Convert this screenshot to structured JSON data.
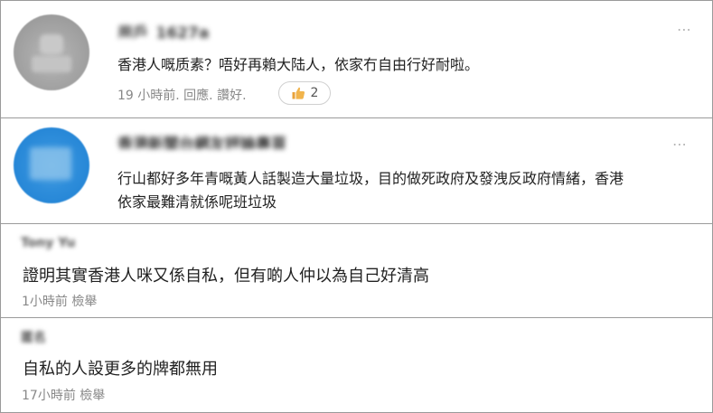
{
  "comments": [
    {
      "username": "用戶_1627a",
      "text": "香港人嘅质素？唔好再賴大陆人，依家冇自由行好耐啦。",
      "time": "19 小時前",
      "reply_label": "回應",
      "like_label": "讚好",
      "like_count": "2",
      "more_icon": "⋯"
    },
    {
      "username": "香港新聞台網友評論專頁",
      "text_line1": "行山都好多年青嘅黃人話製造大量垃圾，目的做死政府及發洩反政府情緒，香港",
      "text_line2": "依家最難清就係呢班垃圾",
      "more_icon": "⋯"
    },
    {
      "username": "Tony Yu",
      "text": "證明其實香港人咪又係自私，但有啲人仲以為自己好清高",
      "time": "1小時前",
      "report_label": "檢舉"
    },
    {
      "username": "匿名",
      "text": "自私的人設更多的牌都無用",
      "time": "17小時前",
      "report_label": "檢舉"
    }
  ],
  "colors": {
    "border": "#9a9a9a",
    "meta": "#888888",
    "like_icon": "#e8a23a",
    "avatar_blue": "#2f8edb",
    "avatar_gray": "#a8a8a8"
  }
}
